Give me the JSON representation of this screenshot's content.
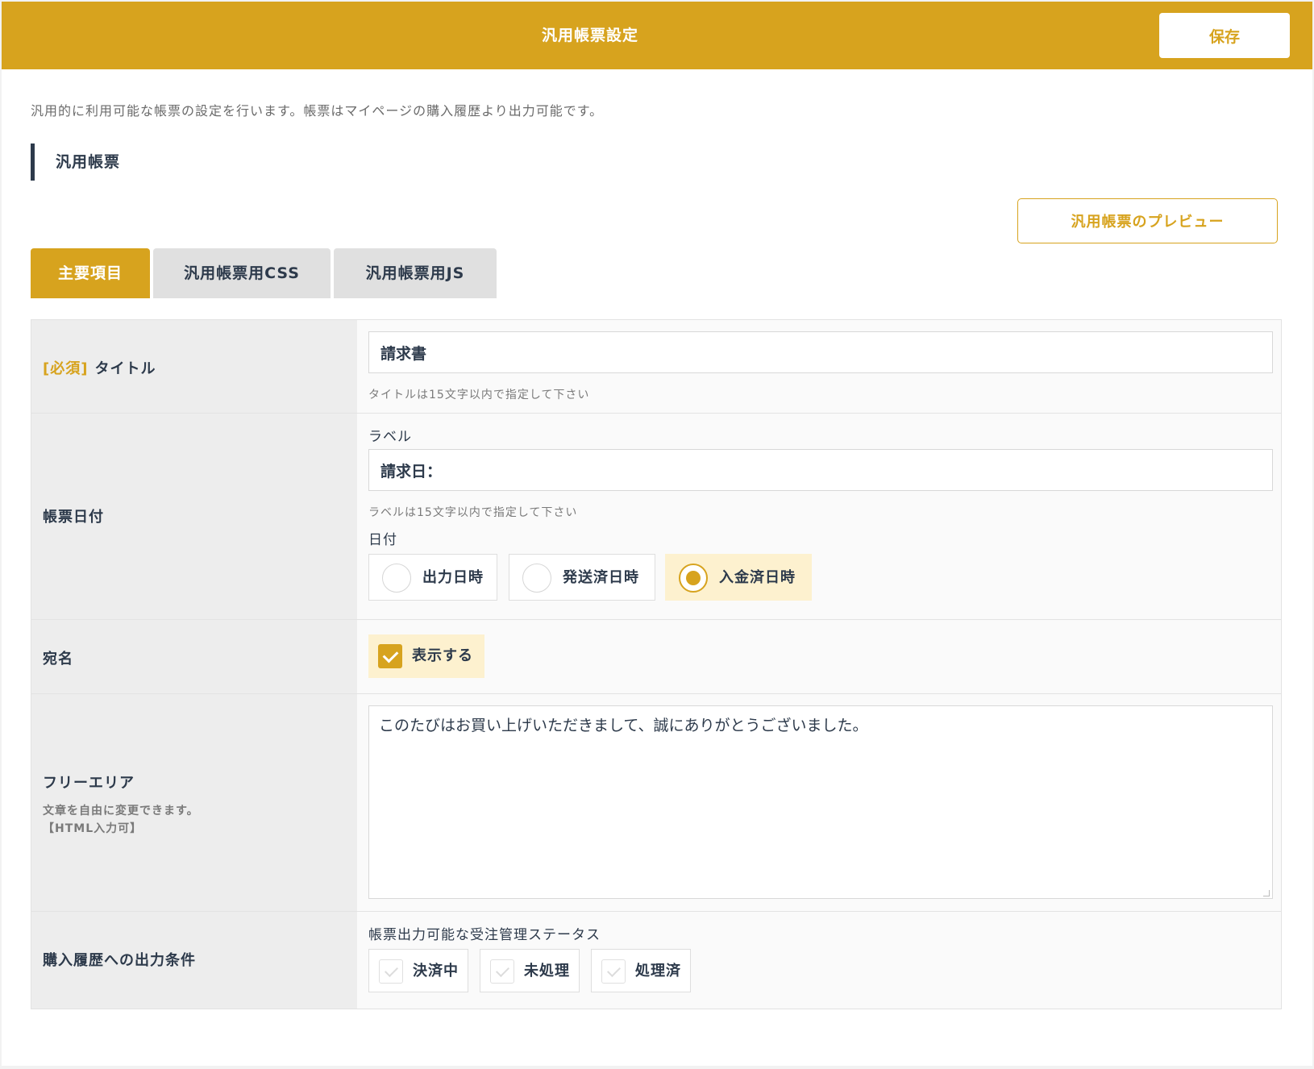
{
  "header": {
    "title": "汎用帳票設定",
    "save_label": "保存"
  },
  "description": "汎用的に利用可能な帳票の設定を行います。帳票はマイページの購入履歴より出力可能です。",
  "section_title": "汎用帳票",
  "preview_label": "汎用帳票のプレビュー",
  "tabs": [
    {
      "label": "主要項目",
      "active": true
    },
    {
      "label": "汎用帳票用CSS",
      "active": false
    },
    {
      "label": "汎用帳票用JS",
      "active": false
    }
  ],
  "form": {
    "title_row": {
      "required_tag": "[必須]",
      "label": "タイトル",
      "value": "請求書",
      "hint": "タイトルは15文字以内で指定して下さい"
    },
    "date_row": {
      "label": "帳票日付",
      "sub_label": "ラベル",
      "label_value": "請求日：",
      "hint": "ラベルは15文字以内で指定して下さい",
      "date_label": "日付",
      "options": [
        {
          "label": "出力日時",
          "selected": false
        },
        {
          "label": "発送済日時",
          "selected": false
        },
        {
          "label": "入金済日時",
          "selected": true
        }
      ]
    },
    "address_row": {
      "label": "宛名",
      "checkbox_label": "表示する",
      "checked": true
    },
    "free_row": {
      "label": "フリーエリア",
      "note1": "文章を自由に変更できます。",
      "note2": "【HTML入力可】",
      "value": "このたびはお買い上げいただきまして、誠にありがとうございました。"
    },
    "condition_row": {
      "label": "購入履歴への出力条件",
      "sub_label": "帳票出力可能な受注管理ステータス",
      "statuses": [
        {
          "label": "決済中",
          "checked": false
        },
        {
          "label": "未処理",
          "checked": false
        },
        {
          "label": "処理済",
          "checked": false
        }
      ]
    }
  },
  "colors": {
    "accent": "#d7a31e",
    "text": "#2d3a4b",
    "selected_bg": "#fdf1cf"
  }
}
